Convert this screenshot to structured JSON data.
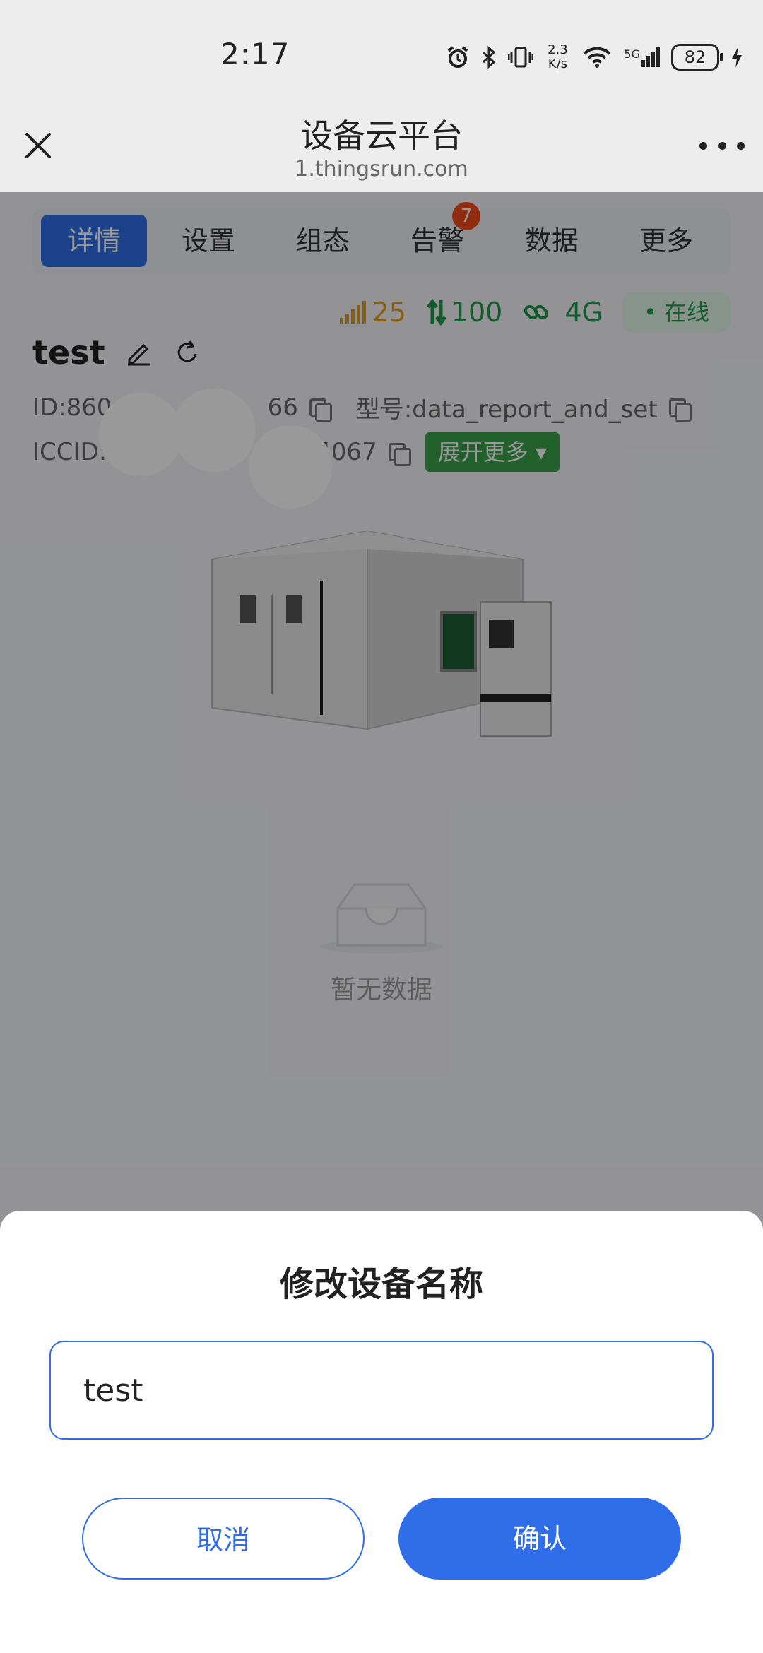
{
  "status_bar": {
    "time": "2:17",
    "net_speed_value": "2.3",
    "net_speed_unit": "K/s",
    "network_type": "5G",
    "battery": "82"
  },
  "titlebar": {
    "title": "设备云平台",
    "subtitle": "1.thingsrun.com"
  },
  "tabs": [
    {
      "label": "详情",
      "active": true
    },
    {
      "label": "设置"
    },
    {
      "label": "组态"
    },
    {
      "label": "告警",
      "badge": "7"
    },
    {
      "label": "数据"
    },
    {
      "label": "更多"
    }
  ],
  "stats": {
    "signal": "25",
    "signal_color": "#e0a11b",
    "transfer": "100",
    "network": "4G",
    "status": "在线",
    "green": "#1f9a4a"
  },
  "device": {
    "name": "test",
    "id_prefix": "ID:860",
    "id_suffix": "66",
    "model": "型号:data_report_and_set",
    "iccid_prefix": "ICCID:",
    "iccid_suffix": "4067",
    "expand_label": "展开更多"
  },
  "empty_state": {
    "text": "暂无数据"
  },
  "dialog": {
    "title": "修改设备名称",
    "input_value": "test",
    "cancel_label": "取消",
    "confirm_label": "确认"
  },
  "colors": {
    "primary": "#2f6ee8",
    "overlay": "rgba(0,0,0,0.40)"
  }
}
